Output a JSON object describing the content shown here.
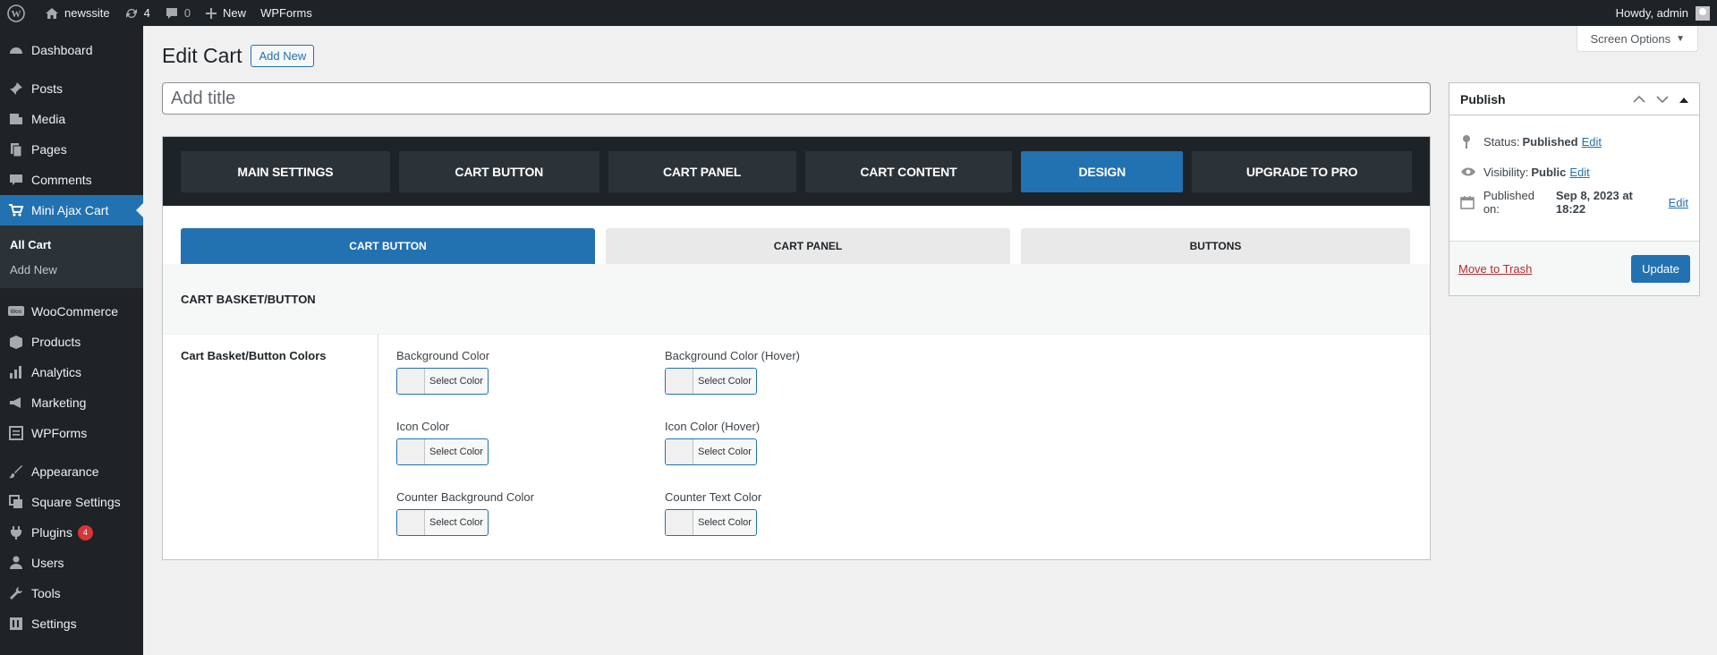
{
  "adminbar": {
    "site_name": "newssite",
    "updates_count": "4",
    "comments_count": "0",
    "new_label": "New",
    "wpforms_label": "WPForms",
    "howdy": "Howdy, admin"
  },
  "sidebar": {
    "items": [
      {
        "label": "Dashboard",
        "icon": "dashboard-icon"
      },
      {
        "label": "Posts",
        "icon": "pin-icon"
      },
      {
        "label": "Media",
        "icon": "media-icon"
      },
      {
        "label": "Pages",
        "icon": "pages-icon"
      },
      {
        "label": "Comments",
        "icon": "comments-icon"
      },
      {
        "label": "Mini Ajax Cart",
        "icon": "cart-icon"
      },
      {
        "label": "WooCommerce",
        "icon": "woo-icon"
      },
      {
        "label": "Products",
        "icon": "products-icon"
      },
      {
        "label": "Analytics",
        "icon": "analytics-icon"
      },
      {
        "label": "Marketing",
        "icon": "megaphone-icon"
      },
      {
        "label": "WPForms",
        "icon": "forms-icon"
      },
      {
        "label": "Appearance",
        "icon": "brush-icon"
      },
      {
        "label": "Square Settings",
        "icon": "settings-squares-icon"
      },
      {
        "label": "Plugins",
        "icon": "plug-icon",
        "badge": "4"
      },
      {
        "label": "Users",
        "icon": "user-icon"
      },
      {
        "label": "Tools",
        "icon": "wrench-icon"
      },
      {
        "label": "Settings",
        "icon": "settings-icon"
      }
    ],
    "submenu": [
      "All Cart",
      "Add New"
    ]
  },
  "header": {
    "screen_options": "Screen Options",
    "title": "Edit Cart",
    "add_new": "Add New",
    "title_placeholder": "Add title"
  },
  "main_tabs": [
    "MAIN SETTINGS",
    "CART BUTTON",
    "CART PANEL",
    "CART CONTENT",
    "DESIGN",
    "UPGRADE TO PRO"
  ],
  "sub_tabs": [
    "CART BUTTON",
    "CART PANEL",
    "BUTTONS"
  ],
  "section": {
    "heading": "CART BASKET/BUTTON",
    "row_label": "Cart Basket/Button Colors",
    "select_color": "Select Color",
    "fields": [
      "Background Color",
      "Background Color (Hover)",
      "Icon Color",
      "Icon Color (Hover)",
      "Counter Background Color",
      "Counter Text Color"
    ]
  },
  "publish": {
    "title": "Publish",
    "status_label": "Status:",
    "status_value": "Published",
    "visibility_label": "Visibility:",
    "visibility_value": "Public",
    "published_label": "Published on:",
    "published_value": "Sep 8, 2023 at 18:22",
    "edit": "Edit",
    "trash": "Move to Trash",
    "update": "Update"
  },
  "colors": {
    "accent": "#2271b1",
    "adminbar": "#1d2327",
    "badge": "#d63638"
  }
}
